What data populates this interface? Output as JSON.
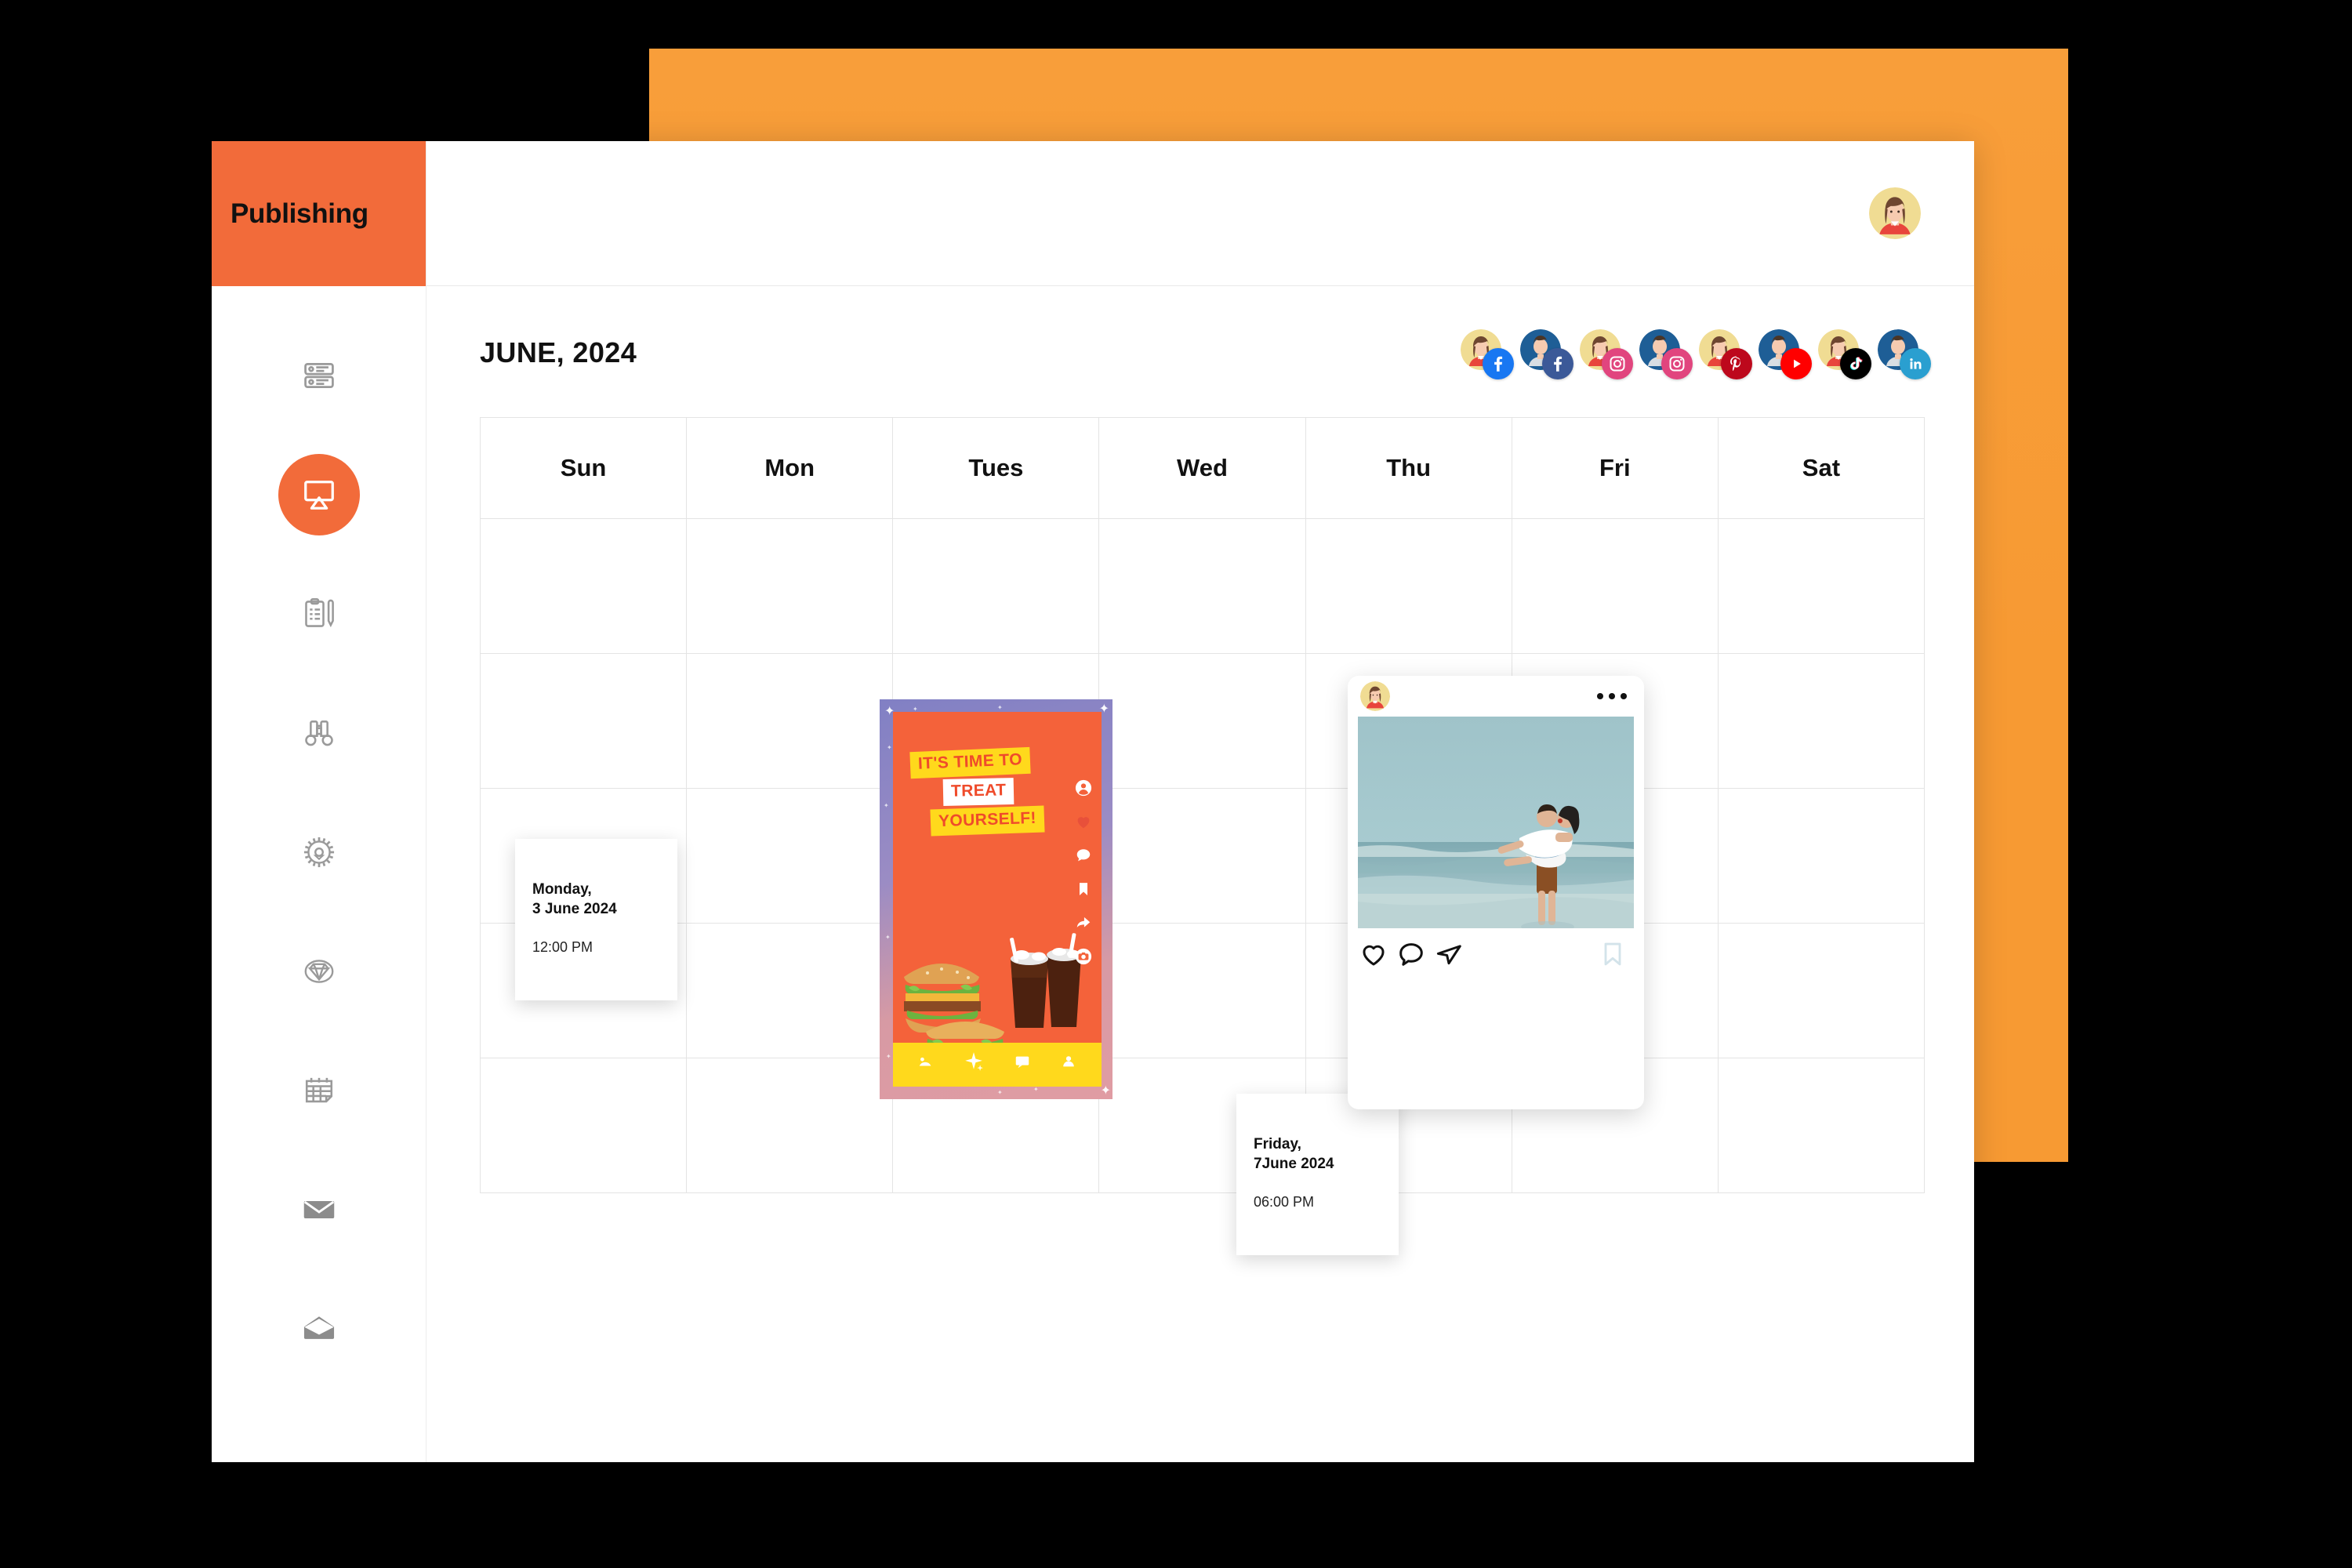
{
  "brand": {
    "title": "Publishing"
  },
  "colors": {
    "accent": "#F26B3A",
    "background_shape": "#F79A33",
    "page_background": "#000000",
    "grid_line": "#E4E4E4"
  },
  "sidebar": {
    "items": [
      {
        "icon": "server-list-icon",
        "active": false
      },
      {
        "icon": "presentation-screen-icon",
        "active": true
      },
      {
        "icon": "clipboard-pen-icon",
        "active": false
      },
      {
        "icon": "binoculars-icon",
        "active": false
      },
      {
        "icon": "gear-icon",
        "active": false
      },
      {
        "icon": "diamond-icon",
        "active": false
      },
      {
        "icon": "calendar-icon",
        "active": false
      },
      {
        "icon": "envelope-closed-icon",
        "active": false
      },
      {
        "icon": "envelope-open-icon",
        "active": false
      }
    ]
  },
  "topbar": {
    "avatar_icon": "user-avatar"
  },
  "calendar": {
    "month_title": "JUNE, 2024",
    "day_headers": [
      "Sun",
      "Mon",
      "Tues",
      "Wed",
      "Thu",
      "Fri",
      "Sat"
    ],
    "week_rows": 5
  },
  "accounts": [
    {
      "platform": "facebook",
      "badge_color": "#FFFFFF",
      "badge_bg": "#1877F2",
      "glyph": "f",
      "avatar": "female"
    },
    {
      "platform": "facebook",
      "badge_color": "#FFFFFF",
      "badge_bg": "#3B5998",
      "glyph": "f",
      "avatar": "male"
    },
    {
      "platform": "instagram",
      "badge_color": "#FFFFFF",
      "badge_bg": "#E1457E",
      "glyph": "ig",
      "avatar": "female"
    },
    {
      "platform": "instagram",
      "badge_color": "#FFFFFF",
      "badge_bg": "#E1457E",
      "glyph": "ig",
      "avatar": "male"
    },
    {
      "platform": "pinterest",
      "badge_color": "#FFFFFF",
      "badge_bg": "#BD081C",
      "glyph": "P",
      "avatar": "female"
    },
    {
      "platform": "youtube",
      "badge_color": "#FFFFFF",
      "badge_bg": "#FF0000",
      "glyph": "yt",
      "avatar": "male"
    },
    {
      "platform": "tiktok",
      "badge_color": "#FFFFFF",
      "badge_bg": "#000000",
      "glyph": "tt",
      "avatar": "female"
    },
    {
      "platform": "linkedin",
      "badge_color": "#FFFFFF",
      "badge_bg": "#2A9FD0",
      "glyph": "in",
      "avatar": "male"
    }
  ],
  "posts": {
    "burger_story": {
      "headline_line1": "IT'S TIME TO",
      "headline_line2": "TREAT",
      "headline_line3": "YOURSELF!",
      "rail_icons": [
        "profile-icon",
        "heart-icon",
        "comment-icon",
        "bookmark-icon",
        "share-icon",
        "camera-icon"
      ],
      "bottom_icons": [
        "sticker-icon",
        "sparkle-icon",
        "text-icon",
        "person-icon"
      ]
    },
    "instagram_post": {
      "more_menu": "more-options-icon",
      "actions": [
        "heart-icon",
        "comment-icon",
        "share-icon",
        "bookmark-icon"
      ],
      "photo_alt": "couple-on-beach"
    }
  },
  "info_cards": [
    {
      "id": "monday",
      "date_line1": "Monday,",
      "date_line2": "3 June 2024",
      "time": "12:00 PM"
    },
    {
      "id": "friday",
      "date_line1": "Friday,",
      "date_line2": "7June 2024",
      "time": "06:00 PM"
    }
  ]
}
